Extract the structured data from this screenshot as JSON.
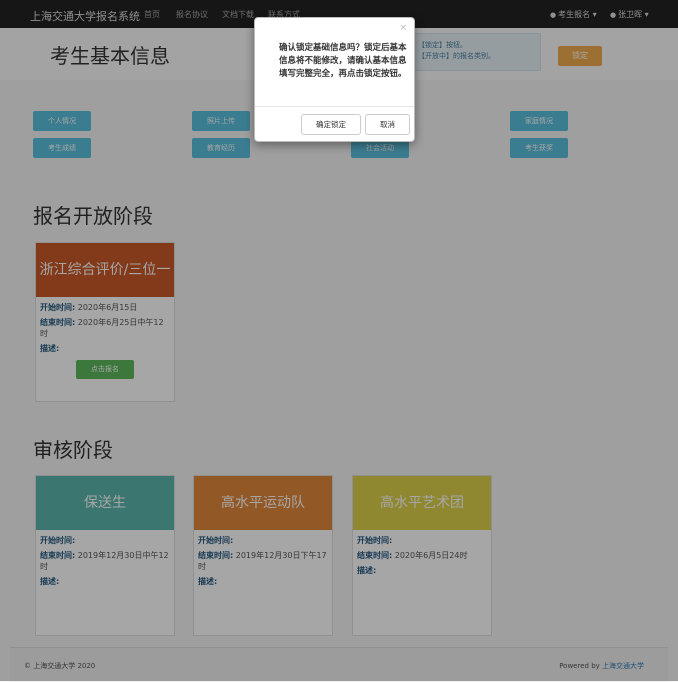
{
  "navbar": {
    "brand": "上海交通大学报名系统",
    "links": [
      "首页",
      "报名协议",
      "文档下载",
      "联系方式"
    ],
    "user_menu": "考生报名",
    "user_name": "张卫晖"
  },
  "header": {
    "title": "考生基本信息",
    "alert_line1": "【锁定】按钮。",
    "alert_line2": "【开放中】的报名类别。",
    "lock_label": "锁定"
  },
  "tabs": [
    "个人情况",
    "照片上传",
    "",
    "家庭情况",
    "考生成绩",
    "教育经历",
    "社会活动",
    "考生获奖"
  ],
  "open_section": {
    "title": "报名开放阶段",
    "card": {
      "head": "浙江综合评价/三位一体",
      "head_color": "#c85a2a",
      "start_label": "开始时间:",
      "start_value": "2020年6月15日",
      "end_label": "结束时间:",
      "end_value": "2020年6月25日中午12时",
      "desc_label": "描述:",
      "apply_label": "点击报名"
    }
  },
  "review_section": {
    "title": "审核阶段",
    "cards": [
      {
        "head": "保送生",
        "head_color": "#5bb5ad",
        "start_label": "开始时间:",
        "start_value": "",
        "end_label": "结束时间:",
        "end_value": "2019年12月30日中午12时",
        "desc_label": "描述:"
      },
      {
        "head": "高水平运动队",
        "head_color": "#e0883a",
        "start_label": "开始时间:",
        "start_value": "",
        "end_label": "结束时间:",
        "end_value": "2019年12月30日下午17时",
        "desc_label": "描述:"
      },
      {
        "head": "高水平艺术团",
        "head_color": "#dcd24a",
        "start_label": "开始时间:",
        "start_value": "",
        "end_label": "结束时间:",
        "end_value": "2020年6月5日24时",
        "desc_label": "描述:"
      }
    ]
  },
  "footer": {
    "copyright": "© 上海交通大学 2020",
    "powered_prefix": "Powered by ",
    "powered_link": "上海交通大学"
  },
  "modal": {
    "close": "×",
    "message": "确认锁定基础信息吗？锁定后基本信息将不能修改，请确认基本信息填写完整完全，再点击锁定按钮。",
    "ok_label": "确定锁定",
    "cancel_label": "取消"
  }
}
